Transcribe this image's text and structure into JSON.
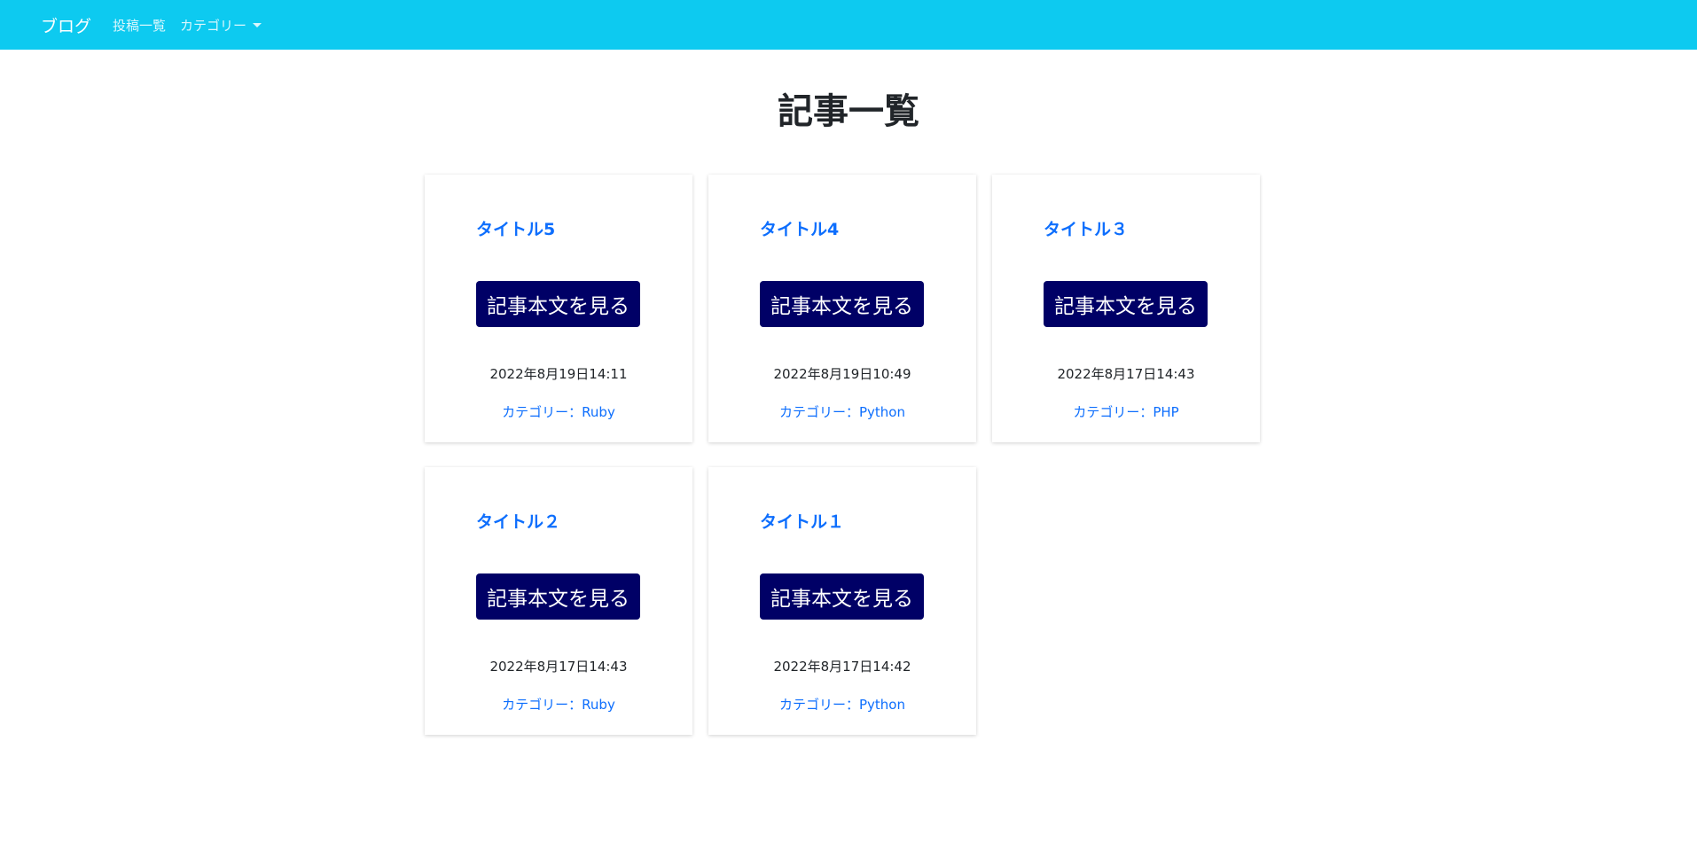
{
  "navbar": {
    "brand": "ブログ",
    "links": {
      "posts": "投稿一覧",
      "categories": "カテゴリー"
    },
    "color": "#0dcaf0"
  },
  "page": {
    "title": "記事一覧"
  },
  "button_color": "#000066",
  "posts": [
    {
      "title": "タイトル5",
      "button": "記事本文を見る",
      "date": "2022年8月19日14:11",
      "category": "カテゴリー：Ruby"
    },
    {
      "title": "タイトル4",
      "button": "記事本文を見る",
      "date": "2022年8月19日10:49",
      "category": "カテゴリー：Python"
    },
    {
      "title": "タイトル３",
      "button": "記事本文を見る",
      "date": "2022年8月17日14:43",
      "category": "カテゴリー：PHP"
    },
    {
      "title": "タイトル２",
      "button": "記事本文を見る",
      "date": "2022年8月17日14:43",
      "category": "カテゴリー：Ruby"
    },
    {
      "title": "タイトル１",
      "button": "記事本文を見る",
      "date": "2022年8月17日14:42",
      "category": "カテゴリー：Python"
    }
  ]
}
